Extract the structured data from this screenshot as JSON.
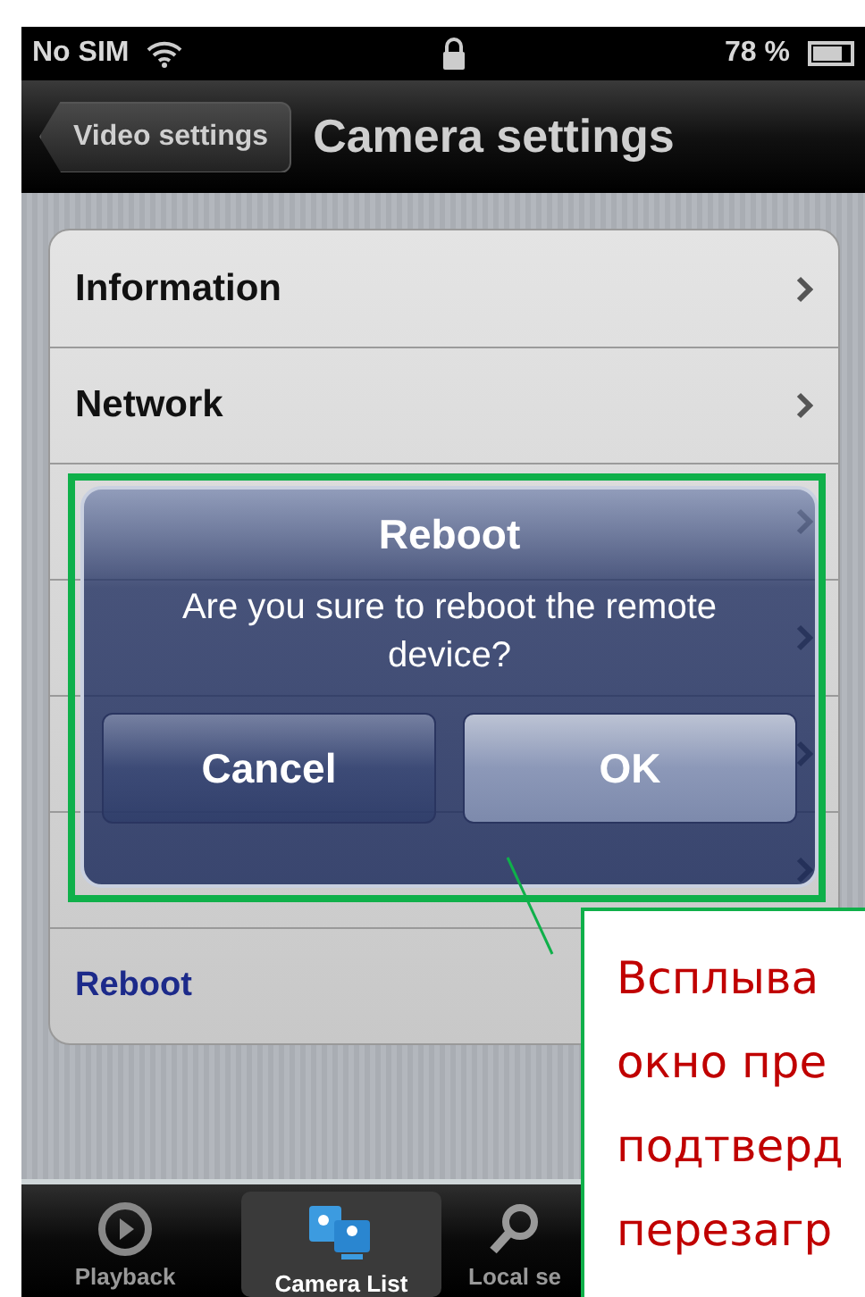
{
  "status_bar": {
    "carrier": "No SIM",
    "battery": "78 %"
  },
  "nav_bar": {
    "back": "Video settings",
    "title": "Camera settings"
  },
  "rows": [
    {
      "label": "Information",
      "kind": "link"
    },
    {
      "label": "Network",
      "kind": "link"
    },
    {
      "kind": "link"
    },
    {
      "kind": "link"
    },
    {
      "kind": "link"
    },
    {
      "kind": "link"
    },
    {
      "label": "Reboot",
      "kind": "action"
    }
  ],
  "alert": {
    "title": "Reboot",
    "message": "Are you sure to reboot the remote device?",
    "buttons": [
      "Cancel",
      "OK"
    ]
  },
  "tabs": [
    {
      "label": "Playback",
      "selected": false,
      "kind": "playback"
    },
    {
      "label": "Camera List",
      "selected": true,
      "kind": "cameras"
    },
    {
      "label": "Local se",
      "selected": false,
      "kind": "search"
    }
  ],
  "callout": {
    "lines": [
      "Всплыва",
      "окно пре",
      "подтверд",
      "перезагр"
    ]
  }
}
